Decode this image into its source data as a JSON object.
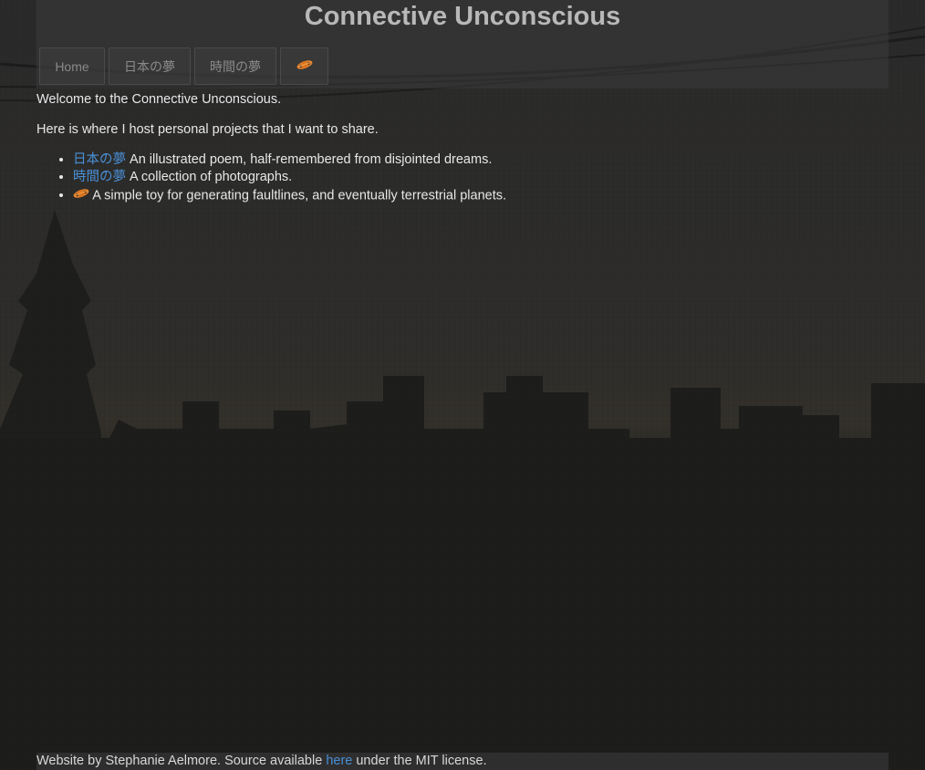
{
  "header": {
    "title": "Connective Unconscious"
  },
  "nav": {
    "items": [
      {
        "label": "Home"
      },
      {
        "label": "日本の夢"
      },
      {
        "label": "時間の夢"
      }
    ],
    "planet_icon": "ringed-planet-icon"
  },
  "main": {
    "welcome": "Welcome to the Connective Unconscious.",
    "intro": "Here is where I host personal projects that I want to share.",
    "projects": [
      {
        "link": "日本の夢",
        "description": "An illustrated poem, half-remembered from disjointed dreams."
      },
      {
        "link": "時間の夢",
        "description": "A collection of photographs."
      },
      {
        "icon": "ringed-planet-icon",
        "description": "A simple toy for generating faultlines, and eventually terrestrial planets."
      }
    ]
  },
  "footer": {
    "prefix": "Website by Stephanie Aelmore. Source available ",
    "link": "here",
    "suffix": " under the MIT license."
  },
  "colors": {
    "link": "#4a8fd6",
    "planet": "#e8842a",
    "background": "#262626"
  }
}
